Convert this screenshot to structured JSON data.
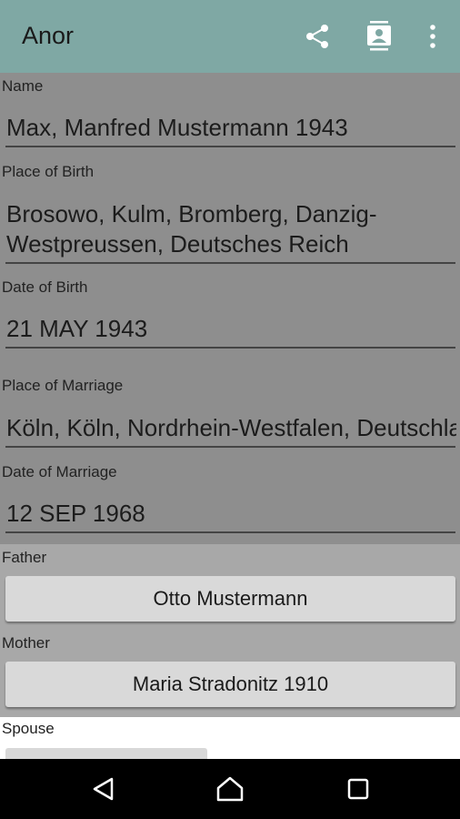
{
  "app_bar": {
    "title": "Anor",
    "icons": [
      "share-icon",
      "contact-card-icon",
      "overflow-menu-icon"
    ],
    "color": "#7fa8a4"
  },
  "fields": [
    {
      "label": "Name",
      "value": "Max, Manfred Mustermann 1943"
    },
    {
      "label": "Place of Birth",
      "value": "Brosowo, Kulm, Bromberg, Danzig-Westpreussen, Deutsches Reich"
    },
    {
      "label": "Date of Birth",
      "value": "21 MAY 1943"
    },
    {
      "label": "Place of Marriage",
      "value": "Köln, Köln, Nordrhein-Westfalen, Deutschland"
    },
    {
      "label": "Date of Marriage",
      "value": "12 SEP 1968"
    }
  ],
  "parents": {
    "father_label": "Father",
    "father_button": "Otto Mustermann",
    "mother_label": "Mother",
    "mother_button": "Maria Stradonitz 1910"
  },
  "spouse": {
    "label": "Spouse"
  },
  "nav_bar": {
    "icons": [
      "back-icon",
      "home-icon",
      "recents-icon"
    ]
  }
}
